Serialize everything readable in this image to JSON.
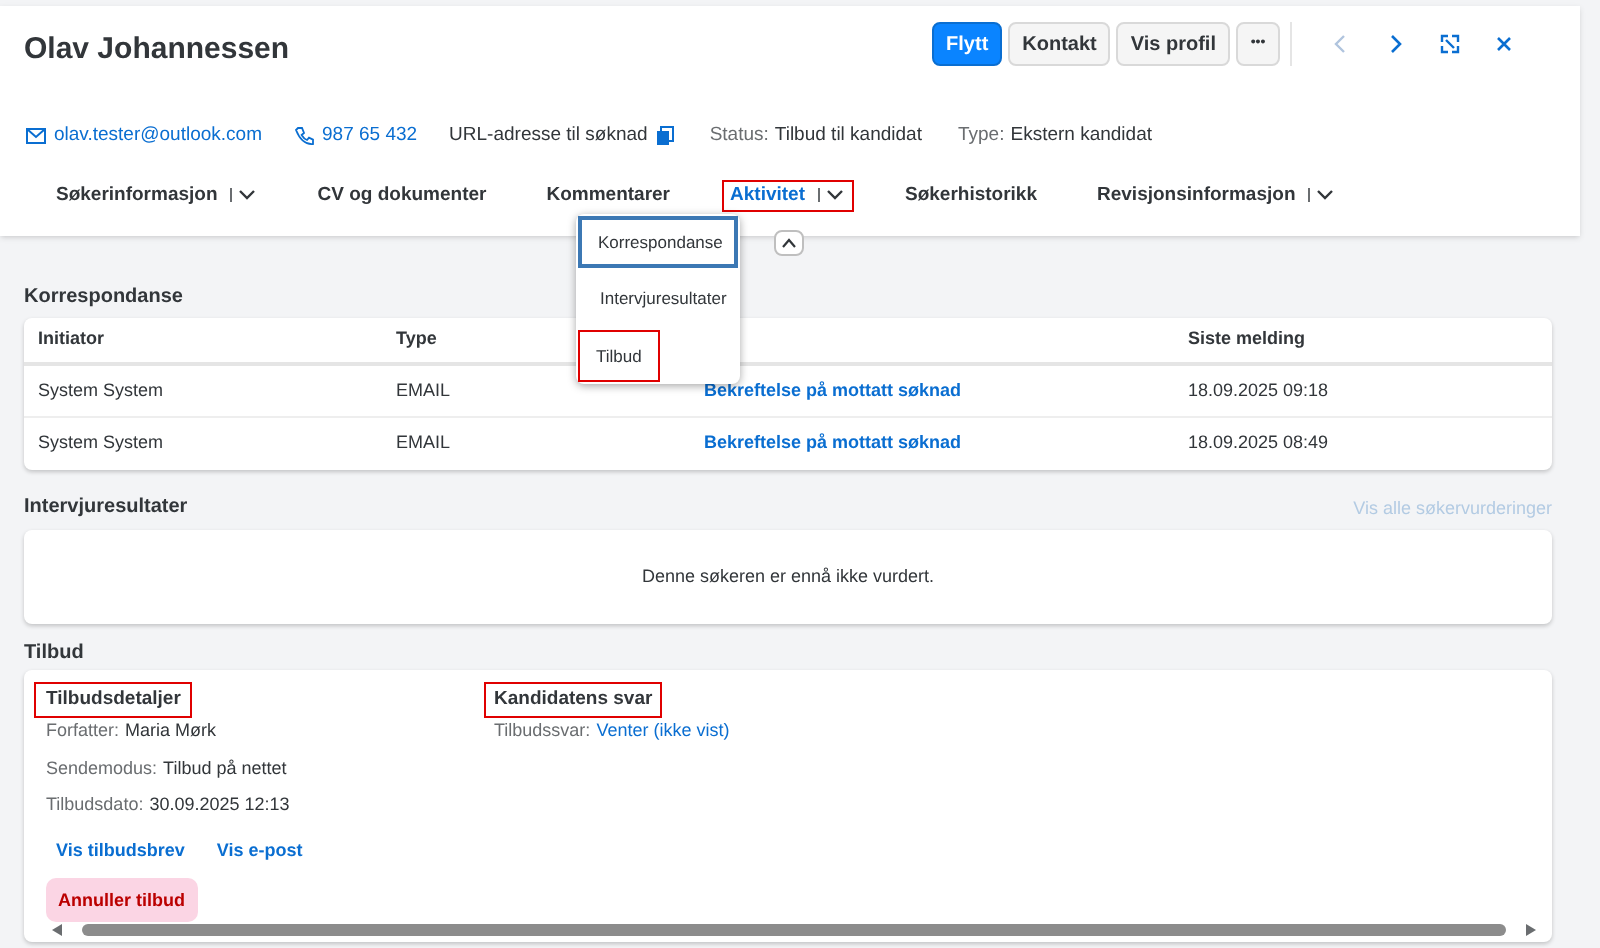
{
  "header": {
    "name": "Olav Johannessen",
    "actions": [
      {
        "label": "Flytt",
        "primary": true
      },
      {
        "label": "Kontakt",
        "primary": false
      },
      {
        "label": "Vis profil",
        "primary": false
      }
    ],
    "more": "•••"
  },
  "info": {
    "email": "olav.tester@outlook.com",
    "phone": "987 65 432",
    "url_label": "URL-adresse til søknad",
    "fields": [
      {
        "label": "Status:",
        "value": "Tilbud til kandidat"
      },
      {
        "label": "Type:",
        "value": "Ekstern kandidat"
      }
    ]
  },
  "tabs": [
    {
      "label": "Søkerinformasjon",
      "has_menu": true,
      "selected": false,
      "highlighted": false
    },
    {
      "label": "CV og dokumenter",
      "has_menu": false,
      "selected": false,
      "highlighted": false
    },
    {
      "label": "Kommentarer",
      "has_menu": false,
      "selected": false,
      "highlighted": false
    },
    {
      "label": "Aktivitet",
      "has_menu": true,
      "selected": true,
      "highlighted": true
    },
    {
      "label": "Søkerhistorikk",
      "has_menu": false,
      "selected": false,
      "highlighted": false
    },
    {
      "label": "Revisjonsinformasjon",
      "has_menu": true,
      "selected": false,
      "highlighted": false
    }
  ],
  "menu": [
    {
      "label": "Korrespondanse",
      "selected": true,
      "highlighted": false
    },
    {
      "label": "Intervjuresultater",
      "selected": false,
      "highlighted": false
    },
    {
      "label": "Tilbud",
      "selected": false,
      "highlighted": true
    }
  ],
  "korrespondanse": {
    "title": "Korrespondanse",
    "columns": {
      "initiator": "Initiator",
      "type": "Type",
      "siste_melding": "Siste melding"
    },
    "rows": [
      {
        "initiator": "System System",
        "type": "EMAIL",
        "column_3": "Bekreftelse på mottatt søknad",
        "siste_melding": "18.09.2025 09:18"
      },
      {
        "initiator": "System System",
        "type": "EMAIL",
        "column_3": "Bekreftelse på mottatt søknad",
        "siste_melding": "18.09.2025 08:49"
      }
    ]
  },
  "intervjuresultater": {
    "title": "Intervjuresultater",
    "link": "Vis alle søkervurderinger",
    "empty_text": "Denne søkeren er ennå ikke vurdert."
  },
  "tilbud": {
    "title": "Tilbud",
    "details": {
      "heading": "Tilbudsdetaljer",
      "highlighted": true,
      "fields": [
        {
          "label": "Forfatter:",
          "value": "Maria Mørk"
        },
        {
          "label": "Sendemodus:",
          "value": "Tilbud på nettet"
        },
        {
          "label": "Tilbudsdato:",
          "value": "30.09.2025 12:13"
        }
      ],
      "links": [
        "Vis tilbudsbrev",
        "Vis e-post"
      ],
      "cancel": "Annuller tilbud"
    },
    "response": {
      "heading": "Kandidatens svar",
      "highlighted": true,
      "label": "Tilbudssvar:",
      "value": "Venter (ikke vist)"
    }
  }
}
